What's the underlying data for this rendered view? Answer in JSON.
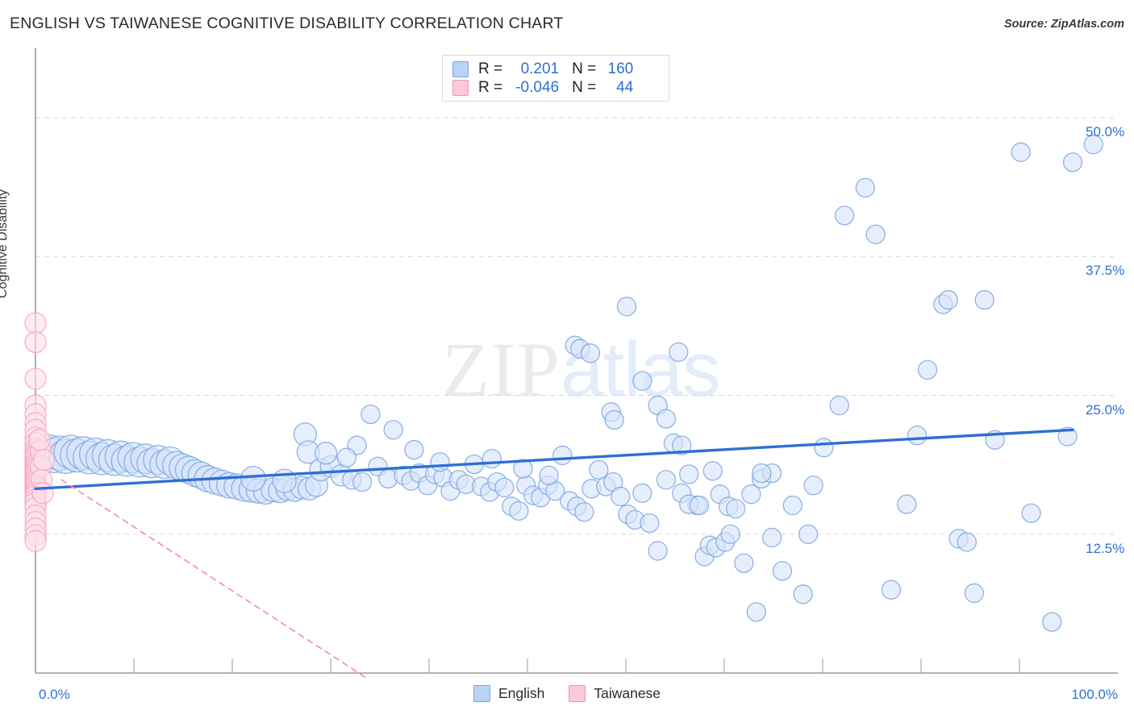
{
  "header": {
    "title": "ENGLISH VS TAIWANESE COGNITIVE DISABILITY CORRELATION CHART",
    "source": "Source: ZipAtlas.com"
  },
  "watermark": {
    "part1": "ZIP",
    "part2": "atlas"
  },
  "stats_legend": {
    "rows": [
      {
        "series": "English",
        "color": "#b9d2f5",
        "r_label": "R =",
        "r_value": "0.201",
        "n_label": "N =",
        "n_value": "160"
      },
      {
        "series": "Taiwanese",
        "color": "#fbc9da",
        "r_label": "R =",
        "r_value": "-0.046",
        "n_label": "N =",
        "n_value": "44"
      }
    ]
  },
  "legend": {
    "items": [
      {
        "label": "English",
        "color": "#bad4f7"
      },
      {
        "label": "Taiwanese",
        "color": "#fbc9da"
      }
    ]
  },
  "colors": {
    "blue_fill": "#d6e4fa",
    "blue_stroke": "#7ba7e0",
    "pink_fill": "#fde0ea",
    "pink_stroke": "#f4a7c0",
    "blue_trend": "#2f6fd4",
    "pink_trend": "#f08cae",
    "grid": "#d9d9d9",
    "axis": "#9a9a9a",
    "tick_text": "#2f6fd4"
  },
  "chart_data": {
    "type": "scatter",
    "title": "ENGLISH VS TAIWANESE COGNITIVE DISABILITY CORRELATION CHART",
    "xlabel": "",
    "ylabel": "Cognitive Disability",
    "xlim": [
      0,
      100
    ],
    "ylim": [
      0,
      56.25
    ],
    "grid": true,
    "legend_position": "bottom-center",
    "x_ticks": [
      0,
      100
    ],
    "x_tick_labels": [
      "0.0%",
      "100.0%"
    ],
    "y_ticks": [
      12.5,
      25.0,
      37.5,
      50.0
    ],
    "y_tick_labels": [
      "12.5%",
      "25.0%",
      "37.5%",
      "50.0%"
    ],
    "series": [
      {
        "name": "English",
        "color": "#d6e4fa",
        "stroke": "#7ba7e0",
        "r": 0.201,
        "n": 160,
        "trendline": {
          "style": "solid",
          "color": "#2f6fd4",
          "x0": 0,
          "y0": 16.6,
          "x1": 100,
          "y1": 21.9
        },
        "points": [
          [
            1.2,
            19.9
          ],
          [
            1.8,
            19.6
          ],
          [
            2.3,
            19.8
          ],
          [
            2.9,
            19.5
          ],
          [
            3.4,
            19.9
          ],
          [
            4.0,
            19.6
          ],
          [
            4.6,
            19.8
          ],
          [
            5.2,
            19.4
          ],
          [
            5.8,
            19.7
          ],
          [
            6.4,
            19.3
          ],
          [
            7.0,
            19.6
          ],
          [
            7.6,
            19.2
          ],
          [
            8.2,
            19.5
          ],
          [
            8.8,
            19.1
          ],
          [
            9.4,
            19.4
          ],
          [
            10.0,
            19.0
          ],
          [
            10.6,
            19.3
          ],
          [
            11.2,
            18.9
          ],
          [
            11.8,
            19.2
          ],
          [
            12.4,
            18.8
          ],
          [
            13.0,
            19.1
          ],
          [
            13.6,
            18.7
          ],
          [
            14.2,
            18.5
          ],
          [
            14.8,
            18.3
          ],
          [
            15.4,
            18.0
          ],
          [
            16.0,
            17.8
          ],
          [
            16.6,
            17.5
          ],
          [
            17.3,
            17.3
          ],
          [
            18.0,
            17.1
          ],
          [
            18.7,
            16.9
          ],
          [
            19.4,
            16.8
          ],
          [
            20.1,
            16.6
          ],
          [
            20.8,
            16.5
          ],
          [
            21.5,
            16.4
          ],
          [
            22.2,
            16.3
          ],
          [
            22.9,
            16.5
          ],
          [
            23.6,
            16.4
          ],
          [
            24.3,
            16.6
          ],
          [
            25.0,
            16.5
          ],
          [
            25.7,
            16.7
          ],
          [
            26.4,
            16.6
          ],
          [
            27.1,
            16.9
          ],
          [
            24.0,
            17.3
          ],
          [
            21.0,
            17.5
          ],
          [
            26.0,
            21.5
          ],
          [
            26.3,
            19.9
          ],
          [
            27.5,
            18.3
          ],
          [
            28.5,
            18.6
          ],
          [
            29.5,
            17.8
          ],
          [
            30.5,
            17.4
          ],
          [
            31.5,
            17.2
          ],
          [
            31.0,
            20.5
          ],
          [
            32.3,
            23.3
          ],
          [
            33.0,
            18.6
          ],
          [
            34.0,
            17.5
          ],
          [
            34.5,
            21.9
          ],
          [
            35.5,
            17.8
          ],
          [
            36.2,
            17.3
          ],
          [
            37.0,
            18.0
          ],
          [
            37.8,
            16.9
          ],
          [
            38.5,
            17.9
          ],
          [
            39.3,
            17.6
          ],
          [
            40.0,
            16.4
          ],
          [
            40.8,
            17.4
          ],
          [
            41.5,
            17.0
          ],
          [
            42.3,
            18.8
          ],
          [
            43.0,
            16.8
          ],
          [
            43.8,
            16.3
          ],
          [
            44.5,
            17.2
          ],
          [
            45.2,
            16.7
          ],
          [
            45.9,
            15.0
          ],
          [
            46.6,
            14.6
          ],
          [
            47.3,
            16.9
          ],
          [
            48.0,
            16.0
          ],
          [
            48.7,
            15.8
          ],
          [
            49.4,
            16.9
          ],
          [
            50.1,
            16.4
          ],
          [
            50.8,
            19.6
          ],
          [
            51.5,
            15.5
          ],
          [
            52.2,
            15.0
          ],
          [
            52.9,
            14.5
          ],
          [
            53.6,
            16.6
          ],
          [
            54.3,
            18.3
          ],
          [
            55.0,
            16.8
          ],
          [
            55.7,
            17.2
          ],
          [
            56.4,
            15.9
          ],
          [
            57.1,
            14.3
          ],
          [
            57.8,
            13.8
          ],
          [
            58.5,
            16.2
          ],
          [
            59.2,
            13.5
          ],
          [
            60.0,
            11.0
          ],
          [
            60.8,
            17.4
          ],
          [
            61.5,
            20.7
          ],
          [
            62.3,
            16.2
          ],
          [
            63.0,
            17.9
          ],
          [
            63.8,
            15.1
          ],
          [
            64.5,
            10.5
          ],
          [
            65.3,
            18.2
          ],
          [
            66.0,
            16.1
          ],
          [
            66.8,
            15.0
          ],
          [
            67.5,
            14.8
          ],
          [
            68.3,
            9.9
          ],
          [
            69.0,
            16.1
          ],
          [
            70.0,
            17.5
          ],
          [
            71.0,
            18.0
          ],
          [
            52.0,
            29.5
          ],
          [
            52.5,
            29.2
          ],
          [
            53.5,
            28.8
          ],
          [
            55.5,
            23.5
          ],
          [
            55.8,
            22.8
          ],
          [
            58.5,
            26.3
          ],
          [
            57.0,
            33.0
          ],
          [
            60.0,
            24.1
          ],
          [
            60.8,
            22.9
          ],
          [
            62.0,
            28.9
          ],
          [
            62.3,
            20.5
          ],
          [
            63.0,
            15.2
          ],
          [
            64.0,
            15.1
          ],
          [
            65.0,
            11.5
          ],
          [
            65.6,
            11.3
          ],
          [
            66.5,
            11.8
          ],
          [
            67.0,
            12.5
          ],
          [
            69.5,
            5.5
          ],
          [
            70.0,
            18.0
          ],
          [
            71.0,
            12.2
          ],
          [
            72.0,
            9.2
          ],
          [
            73.0,
            15.1
          ],
          [
            74.0,
            7.1
          ],
          [
            74.5,
            12.5
          ],
          [
            75.0,
            16.9
          ],
          [
            76.0,
            20.3
          ],
          [
            77.5,
            24.1
          ],
          [
            78.0,
            41.2
          ],
          [
            80.0,
            43.7
          ],
          [
            81.0,
            39.5
          ],
          [
            82.5,
            7.5
          ],
          [
            84.0,
            15.2
          ],
          [
            85.0,
            21.4
          ],
          [
            86.0,
            27.3
          ],
          [
            87.5,
            33.2
          ],
          [
            88.0,
            33.6
          ],
          [
            89.0,
            12.1
          ],
          [
            89.8,
            11.8
          ],
          [
            90.5,
            7.2
          ],
          [
            91.5,
            33.6
          ],
          [
            92.5,
            21.0
          ],
          [
            95.0,
            46.9
          ],
          [
            96.0,
            14.4
          ],
          [
            98.0,
            4.6
          ],
          [
            99.5,
            21.3
          ],
          [
            100.0,
            46.0
          ],
          [
            102.0,
            47.6
          ],
          [
            47.0,
            18.4
          ],
          [
            49.5,
            17.8
          ],
          [
            44.0,
            19.3
          ],
          [
            36.5,
            20.1
          ],
          [
            39.0,
            19.0
          ],
          [
            30.0,
            19.4
          ],
          [
            28.0,
            19.8
          ]
        ]
      },
      {
        "name": "Taiwanese",
        "color": "#fde0ea",
        "stroke": "#f4a7c0",
        "r": -0.046,
        "n": 44,
        "trendline": {
          "style": "dashed",
          "color": "#f08cae",
          "x0": 2.5,
          "y0": 17.4,
          "x1": 32.0,
          "y1": -0.5
        },
        "points": [
          [
            0.0,
            31.5
          ],
          [
            0.0,
            29.8
          ],
          [
            0.0,
            26.5
          ],
          [
            0.0,
            24.1
          ],
          [
            0.0,
            23.3
          ],
          [
            0.0,
            22.5
          ],
          [
            0.0,
            21.9
          ],
          [
            0.0,
            21.2
          ],
          [
            0.0,
            20.7
          ],
          [
            0.0,
            20.2
          ],
          [
            0.0,
            19.9
          ],
          [
            0.0,
            19.6
          ],
          [
            0.0,
            19.4
          ],
          [
            0.0,
            19.1
          ],
          [
            0.0,
            18.9
          ],
          [
            0.0,
            18.7
          ],
          [
            0.0,
            18.5
          ],
          [
            0.0,
            18.3
          ],
          [
            0.0,
            18.1
          ],
          [
            0.0,
            17.9
          ],
          [
            0.0,
            17.7
          ],
          [
            0.0,
            17.5
          ],
          [
            0.0,
            17.3
          ],
          [
            0.0,
            17.1
          ],
          [
            0.0,
            16.9
          ],
          [
            0.0,
            16.7
          ],
          [
            0.0,
            16.5
          ],
          [
            0.0,
            16.3
          ],
          [
            0.0,
            16.1
          ],
          [
            0.0,
            15.9
          ],
          [
            0.0,
            15.6
          ],
          [
            0.0,
            15.3
          ],
          [
            0.0,
            14.9
          ],
          [
            0.0,
            14.2
          ],
          [
            0.0,
            13.6
          ],
          [
            0.0,
            13.0
          ],
          [
            0.0,
            12.4
          ],
          [
            0.0,
            11.9
          ],
          [
            0.5,
            20.0
          ],
          [
            0.5,
            18.6
          ],
          [
            0.6,
            17.4
          ],
          [
            0.7,
            16.2
          ],
          [
            0.8,
            19.2
          ],
          [
            0.4,
            21.0
          ]
        ]
      }
    ]
  }
}
